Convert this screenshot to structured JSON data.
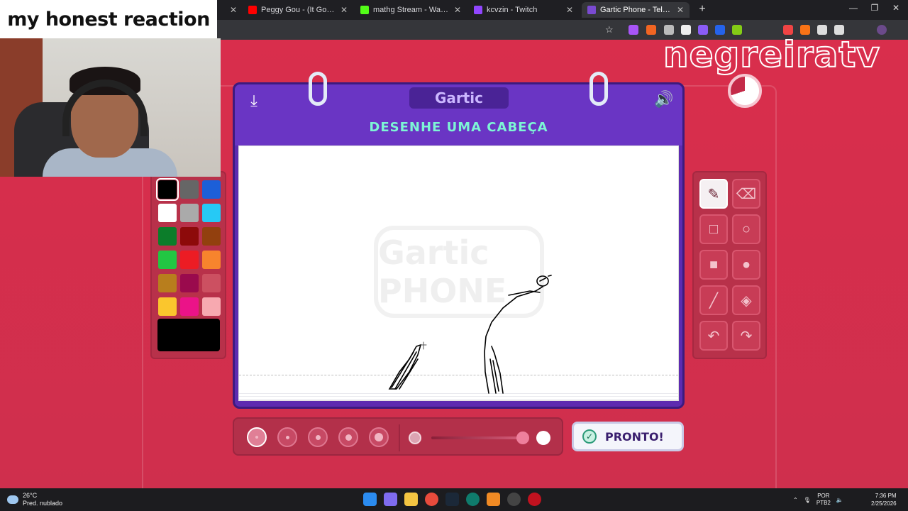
{
  "browser": {
    "tabs": [
      {
        "title": "",
        "active": false,
        "color": "#888888"
      },
      {
        "title": "Peggy Gou - (It Goes Like) I",
        "active": false,
        "color": "#ff0000"
      },
      {
        "title": "mathg Stream - Watch Live on",
        "active": false,
        "color": "#53fc18"
      },
      {
        "title": "kcvzin - Twitch",
        "active": false,
        "color": "#9146ff"
      },
      {
        "title": "Gartic Phone - Telefone sem fio",
        "active": true,
        "color": "#7a4ad1"
      }
    ],
    "new_tab": "+",
    "window_controls": [
      "—",
      "❐",
      "✕"
    ]
  },
  "overlay": {
    "reaction_caption": "my honest reaction",
    "streamer_name": "negreiratv"
  },
  "game": {
    "logo": "Gartic",
    "prompt": "DESENHE UMA CABEÇA",
    "watermark": "Gartic PHONE",
    "download_icon": "⤓",
    "sound_icon": "🔊",
    "palette": {
      "colors": [
        "#000000",
        "#666666",
        "#1c5fd8",
        "#ffffff",
        "#aaaaaa",
        "#26c9f5",
        "#0c7d2a",
        "#8d0a0a",
        "#92400e",
        "#22c643",
        "#ec1c24",
        "#f7842d",
        "#b87e1d",
        "#9a0a4d",
        "#cc5061",
        "#fac62d",
        "#eb1388",
        "#f7a9b0"
      ],
      "selected": "#000000",
      "current": "#000000"
    },
    "tools": [
      {
        "name": "pencil-tool",
        "glyph": "✎",
        "active": true
      },
      {
        "name": "eraser-tool",
        "glyph": "⌫",
        "active": false
      },
      {
        "name": "rectangle-outline-tool",
        "glyph": "□",
        "active": false
      },
      {
        "name": "ellipse-outline-tool",
        "glyph": "○",
        "active": false
      },
      {
        "name": "rectangle-fill-tool",
        "glyph": "■",
        "active": false
      },
      {
        "name": "ellipse-fill-tool",
        "glyph": "●",
        "active": false
      },
      {
        "name": "line-tool",
        "glyph": "╱",
        "active": false
      },
      {
        "name": "fill-bucket-tool",
        "glyph": "◈",
        "active": false
      },
      {
        "name": "undo-tool",
        "glyph": "↶",
        "active": false
      },
      {
        "name": "redo-tool",
        "glyph": "↷",
        "active": false
      }
    ],
    "brush_sizes": [
      {
        "size": 1,
        "active": true
      },
      {
        "size": 2,
        "active": false
      },
      {
        "size": 3,
        "active": false
      },
      {
        "size": 4,
        "active": false
      },
      {
        "size": 5,
        "active": false
      }
    ],
    "opacity_level": 1.0,
    "done_button": "PRONTO!"
  },
  "taskbar": {
    "temperature": "26°C",
    "weather": "Pred. nublado",
    "language": "POR",
    "keyboard": "PTB2",
    "time": "7:36 PM",
    "date": "2/25/2026"
  }
}
